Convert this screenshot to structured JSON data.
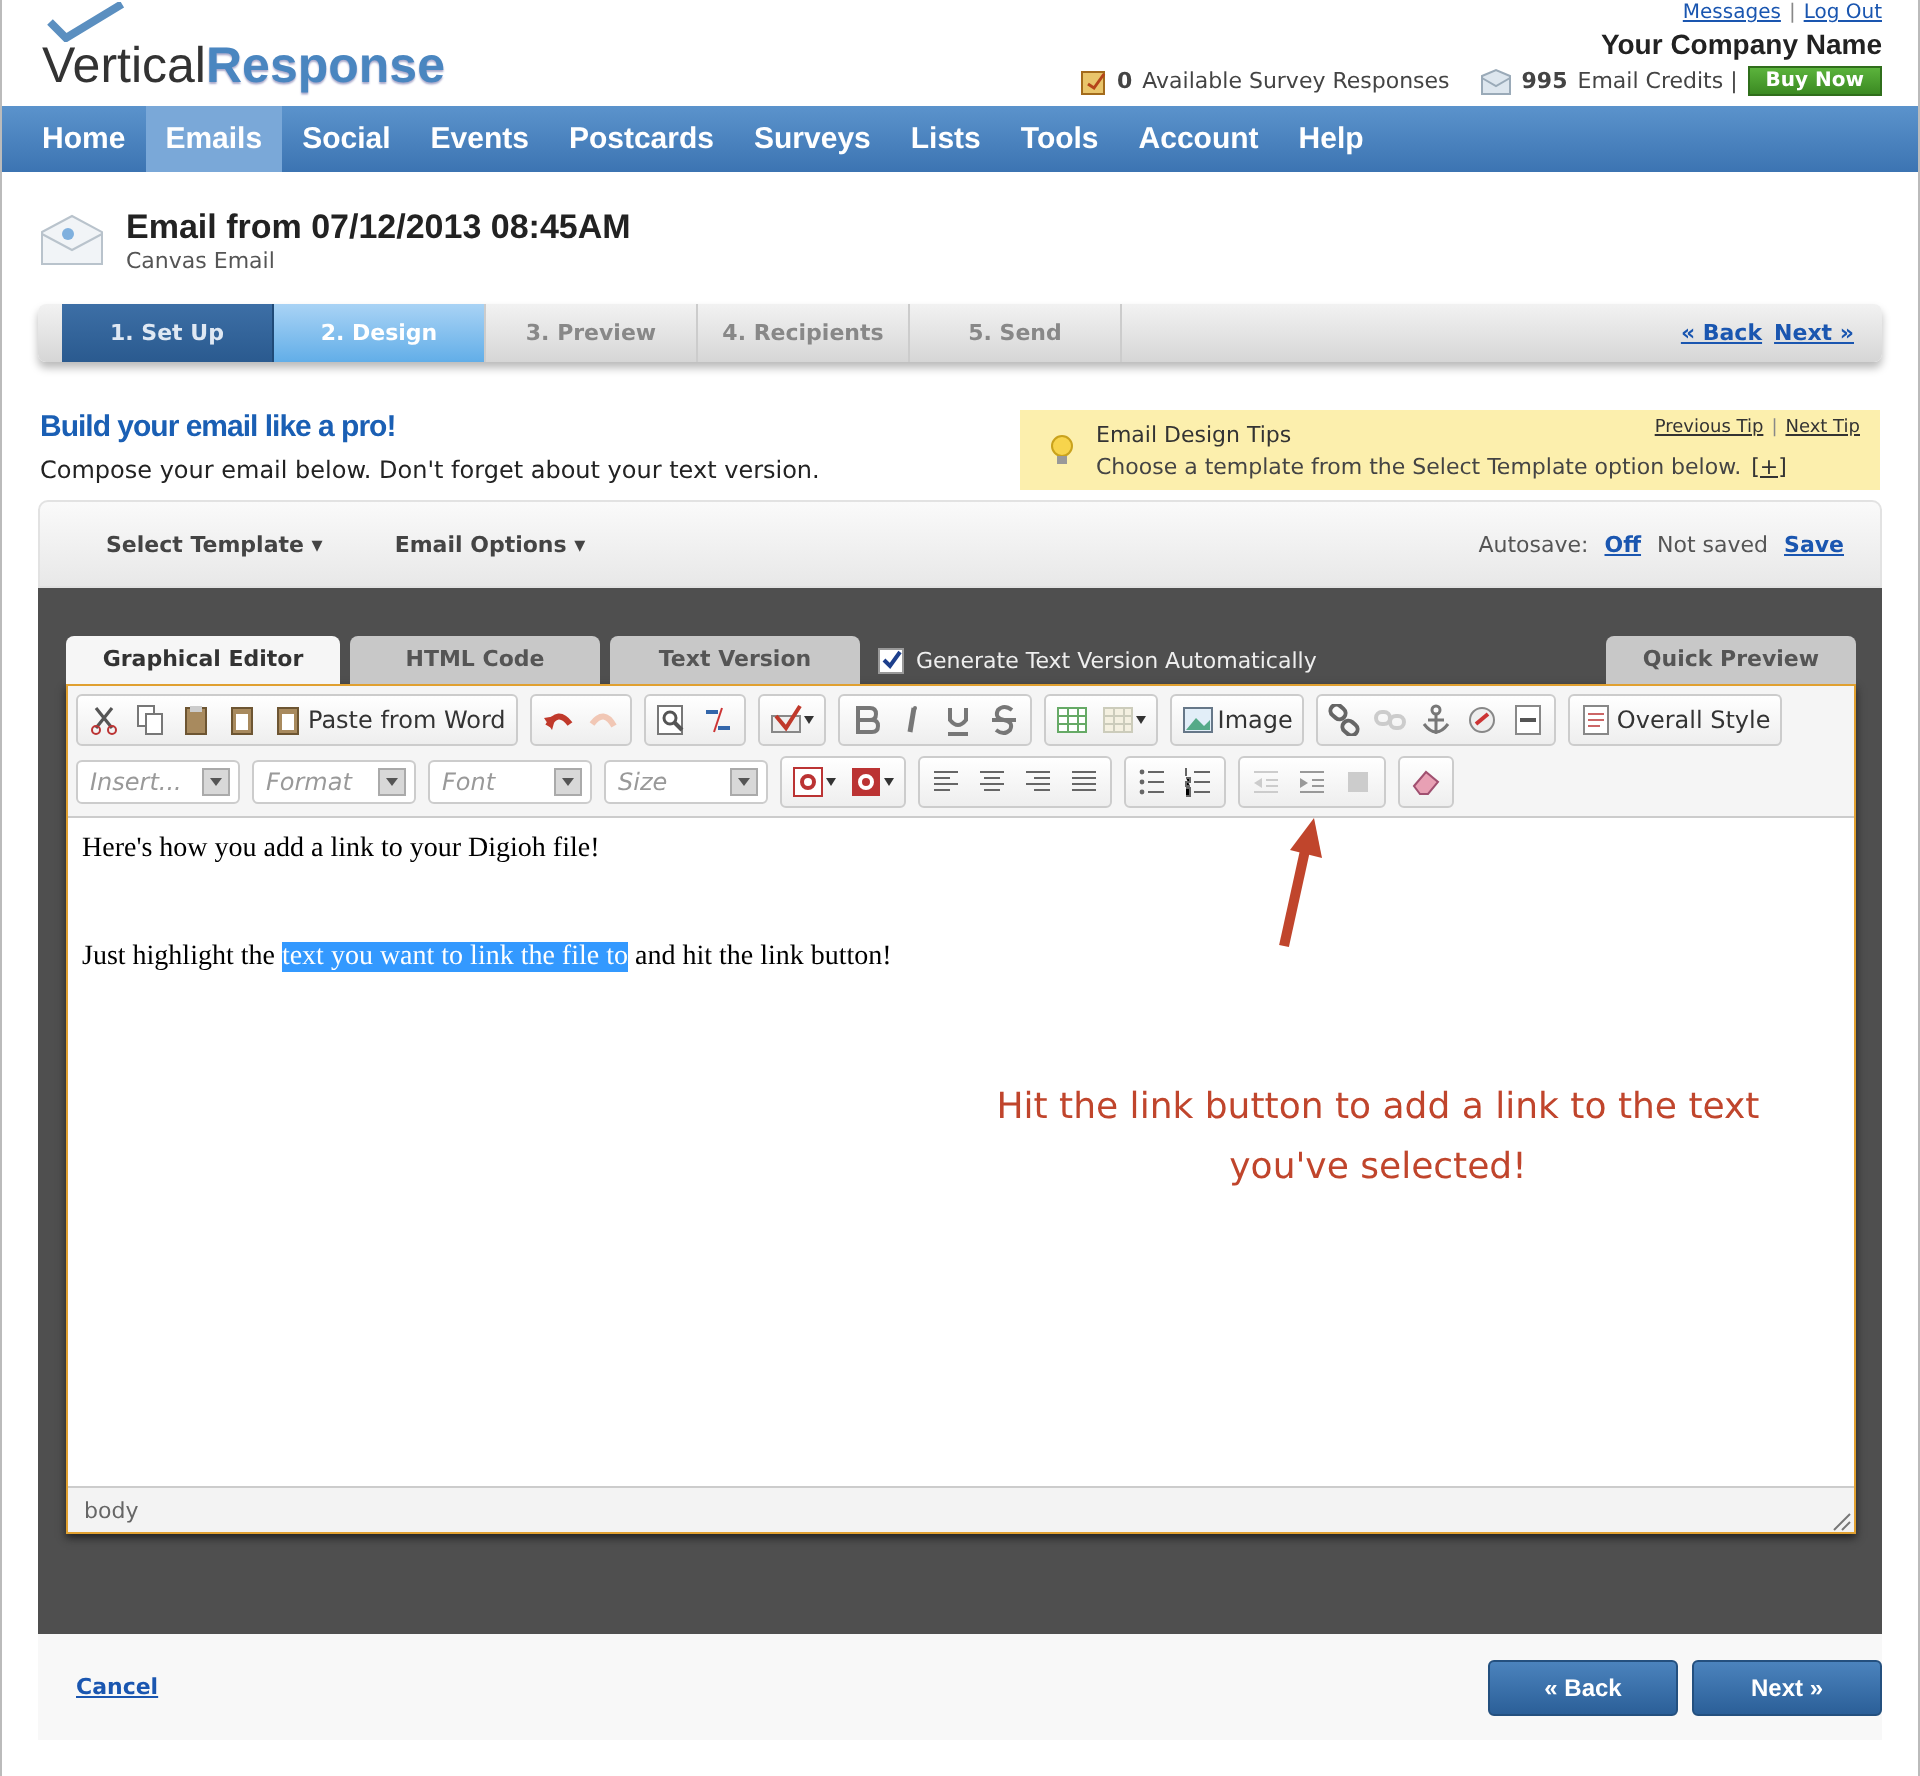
{
  "header": {
    "logo_prefix": "V",
    "logo_mid": "ertical",
    "logo_suffix": "Response",
    "links": [
      "Messages",
      "Log Out"
    ],
    "separator": "|",
    "company": "Your Company Name",
    "survey_count": "0",
    "survey_label": "Available Survey Responses",
    "credits_count": "995",
    "credits_label": "Email Credits |",
    "buy_button": "Buy Now"
  },
  "nav": [
    {
      "label": "Home",
      "selected": false
    },
    {
      "label": "Emails",
      "selected": true
    },
    {
      "label": "Social",
      "selected": false
    },
    {
      "label": "Events",
      "selected": false
    },
    {
      "label": "Postcards",
      "selected": false
    },
    {
      "label": "Surveys",
      "selected": false
    },
    {
      "label": "Lists",
      "selected": false
    },
    {
      "label": "Tools",
      "selected": false
    },
    {
      "label": "Account",
      "selected": false
    },
    {
      "label": "Help",
      "selected": false
    }
  ],
  "email": {
    "title": "Email from 07/12/2013 08:45AM",
    "subtitle": "Canvas Email"
  },
  "steps": [
    {
      "label": "1. Set Up",
      "selected": false,
      "completed": true
    },
    {
      "label": "2. Design",
      "selected": true,
      "completed": false
    },
    {
      "label": "3. Preview",
      "selected": false,
      "completed": false
    },
    {
      "label": "4. Recipients",
      "selected": false,
      "completed": false
    },
    {
      "label": "5. Send",
      "selected": false,
      "completed": false
    }
  ],
  "step_links": [
    "« Back",
    "Next »"
  ],
  "intro": {
    "heading": "Build your email like a pro!",
    "text": "Compose your email below.  Don't forget about your text version."
  },
  "tips": {
    "title": "Email Design Tips",
    "text": "Choose a template from the Select Template option below.",
    "more": "[+]",
    "links": [
      "Previous Tip",
      "Next Tip"
    ],
    "separator": "|"
  },
  "template_bar": {
    "menus": [
      "Select Template ▾",
      "Email Options ▾"
    ],
    "autosave_label": "Autosave:",
    "autosave_value": "Off",
    "status": "Not saved",
    "save": "Save"
  },
  "editor_tabs": [
    {
      "label": "Graphical Editor",
      "selected": true
    },
    {
      "label": "HTML Code",
      "selected": false
    },
    {
      "label": "Text Version",
      "selected": false
    }
  ],
  "generate_text": {
    "label": "Generate Text Version Automatically",
    "checked": true
  },
  "quick_preview": "Quick Preview",
  "toolbar": {
    "buttons": [
      "Paste from Word",
      "Image",
      "Overall Style"
    ],
    "dropdowns": [
      {
        "placeholder": "Insert..."
      },
      {
        "placeholder": "Format"
      },
      {
        "placeholder": "Font"
      },
      {
        "placeholder": "Size"
      }
    ]
  },
  "content": {
    "lines": [
      {
        "before": "Here's how you add a link to your Digioh file!"
      },
      {
        "before": "Just highlight the ",
        "selected": "text you want to link the file to",
        "after": " and hit the link button!"
      }
    ]
  },
  "status_path": "body",
  "annotation": "Hit the link button to add a link to the text you've selected!",
  "footer": {
    "cancel": "Cancel",
    "buttons": [
      "« Back",
      "Next »"
    ]
  }
}
